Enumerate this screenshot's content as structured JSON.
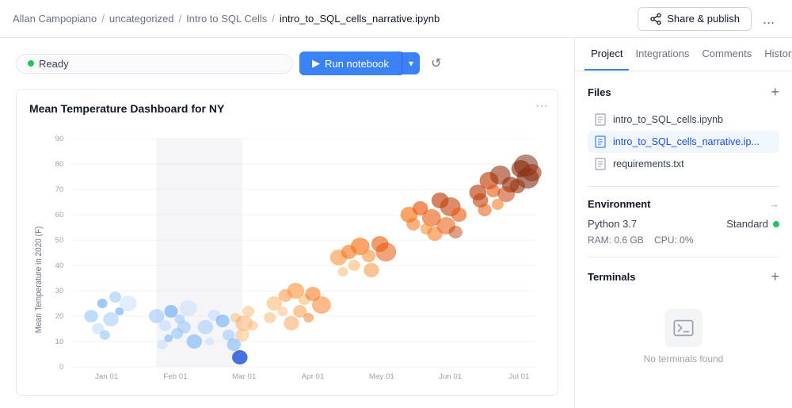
{
  "topbar": {
    "breadcrumb": [
      "Allan Campopiano",
      "uncategorized",
      "Intro to SQL Cells",
      "intro_to_SQL_cells_narrative.ipynb"
    ],
    "share_label": "Share & publish",
    "more_label": "..."
  },
  "toolbar": {
    "status_label": "Ready",
    "run_label": "Run notebook",
    "run_arrow_label": "▾",
    "refresh_label": "↺"
  },
  "chart": {
    "title": "Mean Temperature Dashboard for NY",
    "y_label": "Mean Temperature in 2020 (F)",
    "y_max": 90,
    "y_ticks": [
      0,
      10,
      20,
      30,
      40,
      50,
      60,
      70,
      80,
      90
    ],
    "x_labels": [
      "Jan 01",
      "Feb 01",
      "Mar 01",
      "Apr 01",
      "May 01",
      "Jun 01",
      "Jul 01"
    ],
    "more_label": "···"
  },
  "sidebar": {
    "tabs": [
      {
        "label": "Project",
        "active": true
      },
      {
        "label": "Integrations",
        "active": false
      },
      {
        "label": "Comments",
        "active": false
      },
      {
        "label": "History",
        "active": false
      }
    ],
    "files_section": {
      "title": "Files",
      "add_label": "+",
      "items": [
        {
          "name": "intro_to_SQL_cells.ipynb",
          "type": "notebook",
          "active": false
        },
        {
          "name": "intro_to_SQL_cells_narrative.ip...",
          "type": "notebook",
          "active": true
        },
        {
          "name": "requirements.txt",
          "type": "text",
          "active": false
        }
      ]
    },
    "environment_section": {
      "title": "Environment",
      "python_version": "Python 3.7",
      "env_type": "Standard",
      "ram_label": "RAM: 0.6 GB",
      "cpu_label": "CPU: 0%"
    },
    "terminals_section": {
      "title": "Terminals",
      "add_label": "+",
      "empty_text": "No terminals found"
    }
  }
}
